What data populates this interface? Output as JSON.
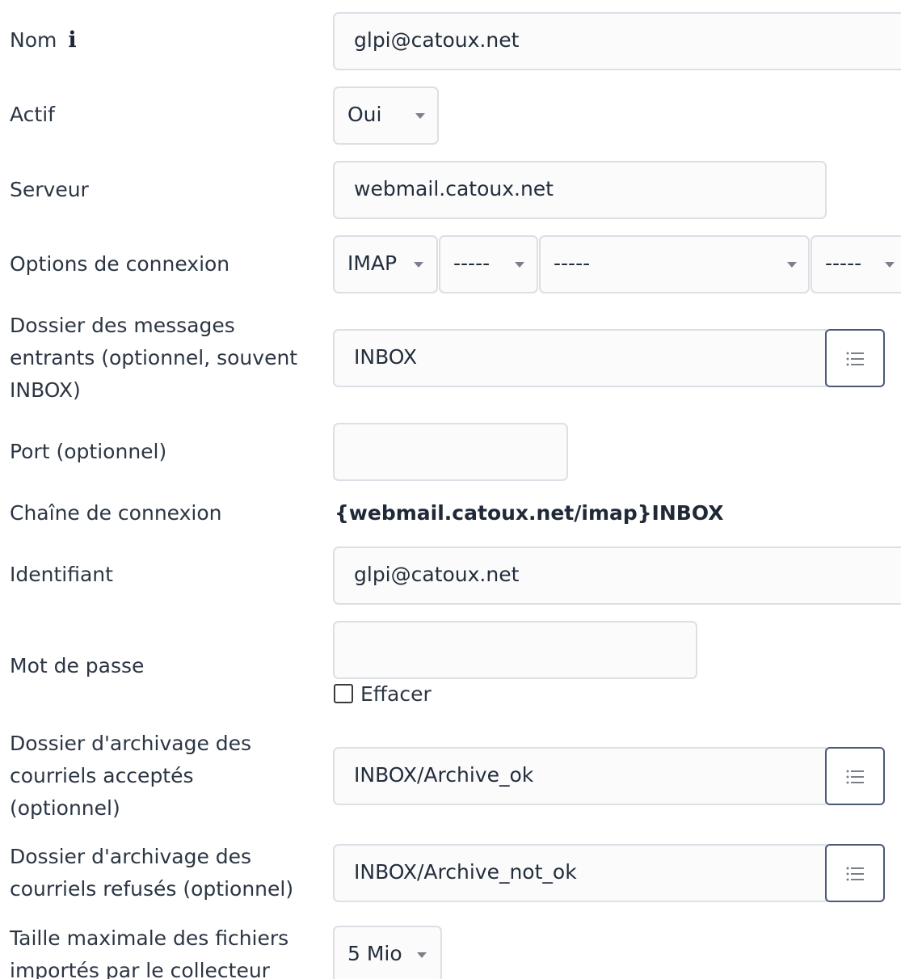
{
  "form": {
    "nom": {
      "label": "Nom",
      "info_icon": "i",
      "value": "glpi@catoux.net"
    },
    "actif": {
      "label": "Actif",
      "value": "Oui"
    },
    "serveur": {
      "label": "Serveur",
      "value": "webmail.catoux.net"
    },
    "options": {
      "label": "Options de connexion",
      "selects": [
        "IMAP",
        "-----",
        "-----",
        "-----"
      ]
    },
    "dossier_entrants": {
      "label_lines": [
        "Dossier des messages",
        "entrants (optionnel, souvent",
        "INBOX)"
      ],
      "value": "INBOX",
      "button_icon": "list-icon"
    },
    "port": {
      "label": "Port (optionnel)",
      "value": ""
    },
    "chaine": {
      "label": "Chaîne de connexion",
      "value": "{webmail.catoux.net/imap}INBOX"
    },
    "identifiant": {
      "label": "Identifiant",
      "value": "glpi@catoux.net"
    },
    "mot_de_passe": {
      "label": "Mot de passe",
      "value": "",
      "clear_label": "Effacer",
      "clear_checked": false
    },
    "archive_ok": {
      "label_lines": [
        "Dossier d'archivage des",
        "courriels acceptés",
        "(optionnel)"
      ],
      "value": "INBOX/Archive_ok",
      "button_icon": "list-icon"
    },
    "archive_not_ok": {
      "label_lines": [
        "Dossier d'archivage des",
        "courriels refusés (optionnel)"
      ],
      "value": "INBOX/Archive_not_ok",
      "button_icon": "list-icon"
    },
    "taille_max": {
      "label_lines": [
        "Taille maximale des fichiers",
        "importés par le collecteur"
      ],
      "value": "5 Mio"
    }
  },
  "colors": {
    "field_bg": "#fbfbfc",
    "field_border": "#dcdfe5",
    "button_border": "#4a5a75",
    "text": "#2c3644"
  }
}
